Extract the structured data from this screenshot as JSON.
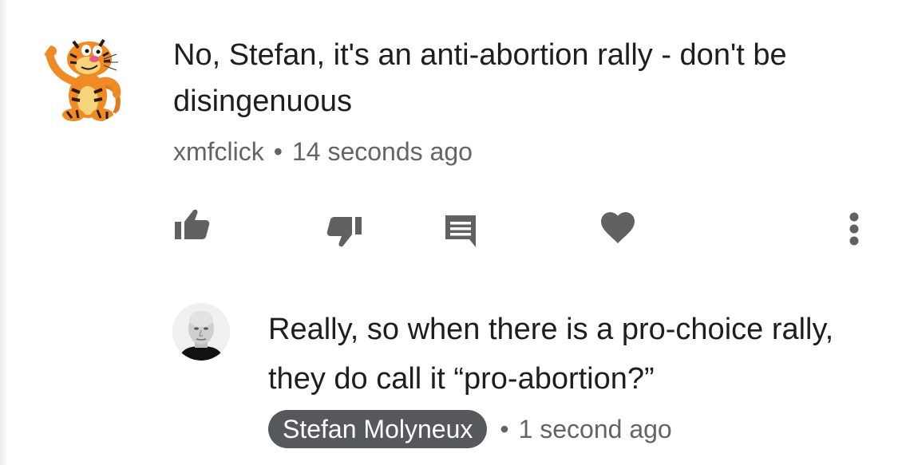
{
  "comment": {
    "text": "No, Stefan, it's an anti-abortion rally - don't be disingenuous",
    "author": "xmfclick",
    "separator": "•",
    "timestamp": "14 seconds ago",
    "avatar_icon": "tiger-cartoon-avatar"
  },
  "actions": {
    "like_icon": "thumbs-up-icon",
    "dislike_icon": "thumbs-down-icon",
    "reply_icon": "comment-icon",
    "heart_icon": "heart-icon",
    "more_icon": "more-vertical-icon",
    "icon_color": "#616161"
  },
  "reply": {
    "text": "Really, so when there is a pro-choice rally, they do call it “pro-abortion?”",
    "author": "Stefan Molyneux",
    "separator": "•",
    "timestamp": "1 second ago",
    "author_badge_color": "#56595c",
    "avatar_icon": "person-photo-avatar"
  }
}
